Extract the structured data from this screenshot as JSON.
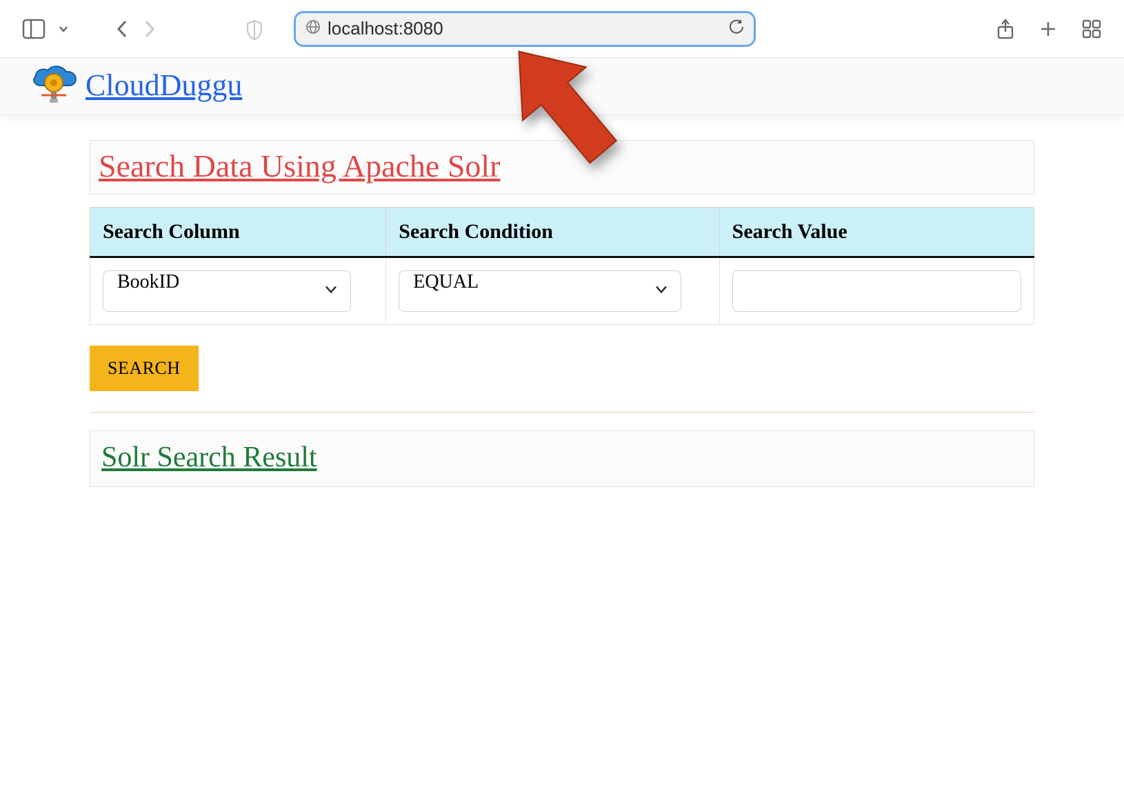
{
  "browser": {
    "url": "localhost:8080"
  },
  "header": {
    "brand": "CloudDuggu"
  },
  "main": {
    "title": "Search Data Using Apache Solr",
    "columns": {
      "col1": "Search Column",
      "col2": "Search Condition",
      "col3": "Search Value"
    },
    "form": {
      "column_value": "BookID",
      "condition_value": "EQUAL",
      "value_input": ""
    },
    "search_button": "SEARCH",
    "result_title": "Solr Search Result"
  }
}
